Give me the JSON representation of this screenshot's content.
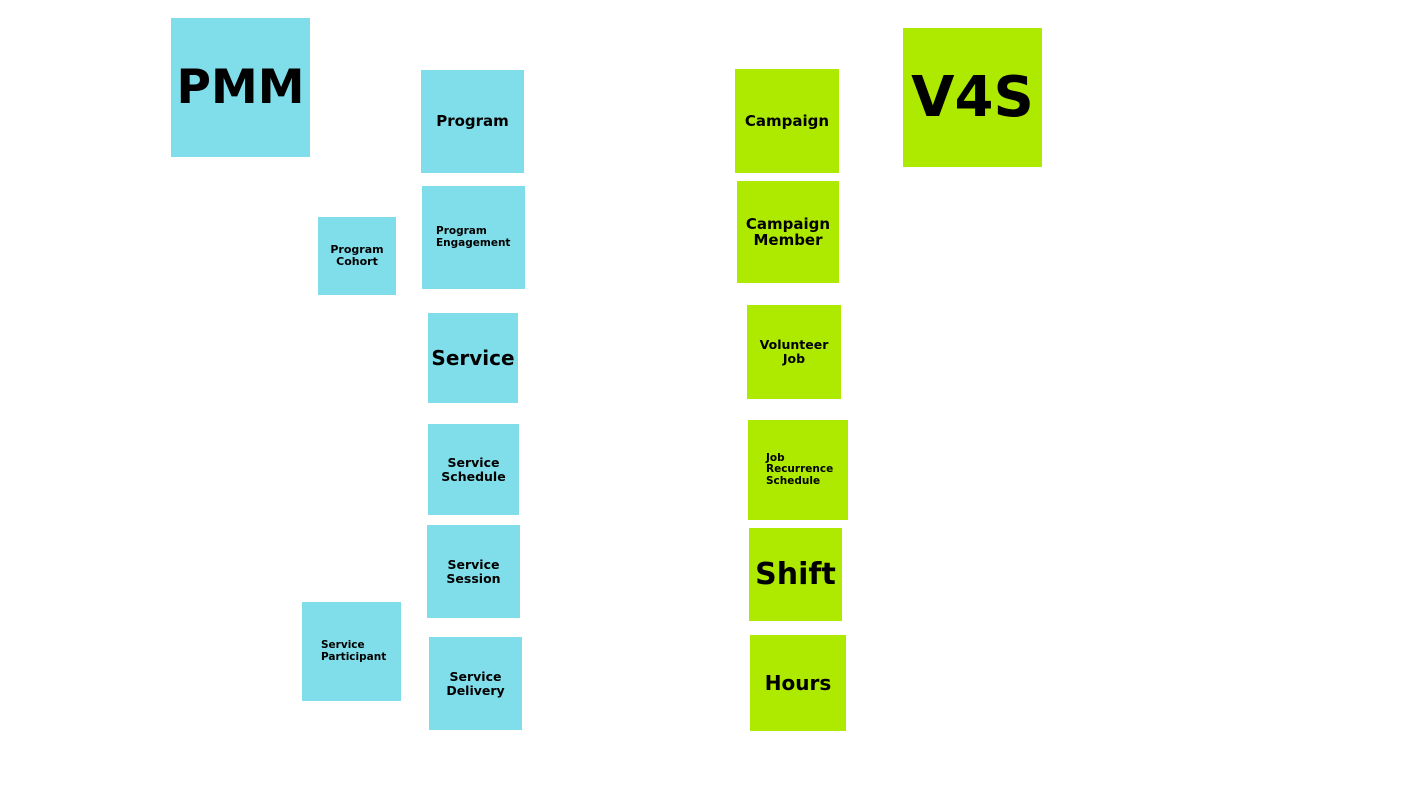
{
  "pmm": {
    "title": "PMM",
    "color": "#80deea",
    "notes": {
      "program": "Program",
      "program_engagement": "Program\nEngagement",
      "program_cohort": "Program\nCohort",
      "service": "Service",
      "service_schedule": "Service\nSchedule",
      "service_session": "Service\nSession",
      "service_participant": "Service\nParticipant",
      "service_delivery": "Service\nDelivery"
    }
  },
  "v4s": {
    "title": "V4S",
    "color": "#aeea00",
    "notes": {
      "campaign": "Campaign",
      "campaign_member": "Campaign\nMember",
      "volunteer_job": "Volunteer\nJob",
      "job_recurrence_schedule": "Job\nRecurrence\nSchedule",
      "shift": "Shift",
      "hours": "Hours"
    }
  }
}
